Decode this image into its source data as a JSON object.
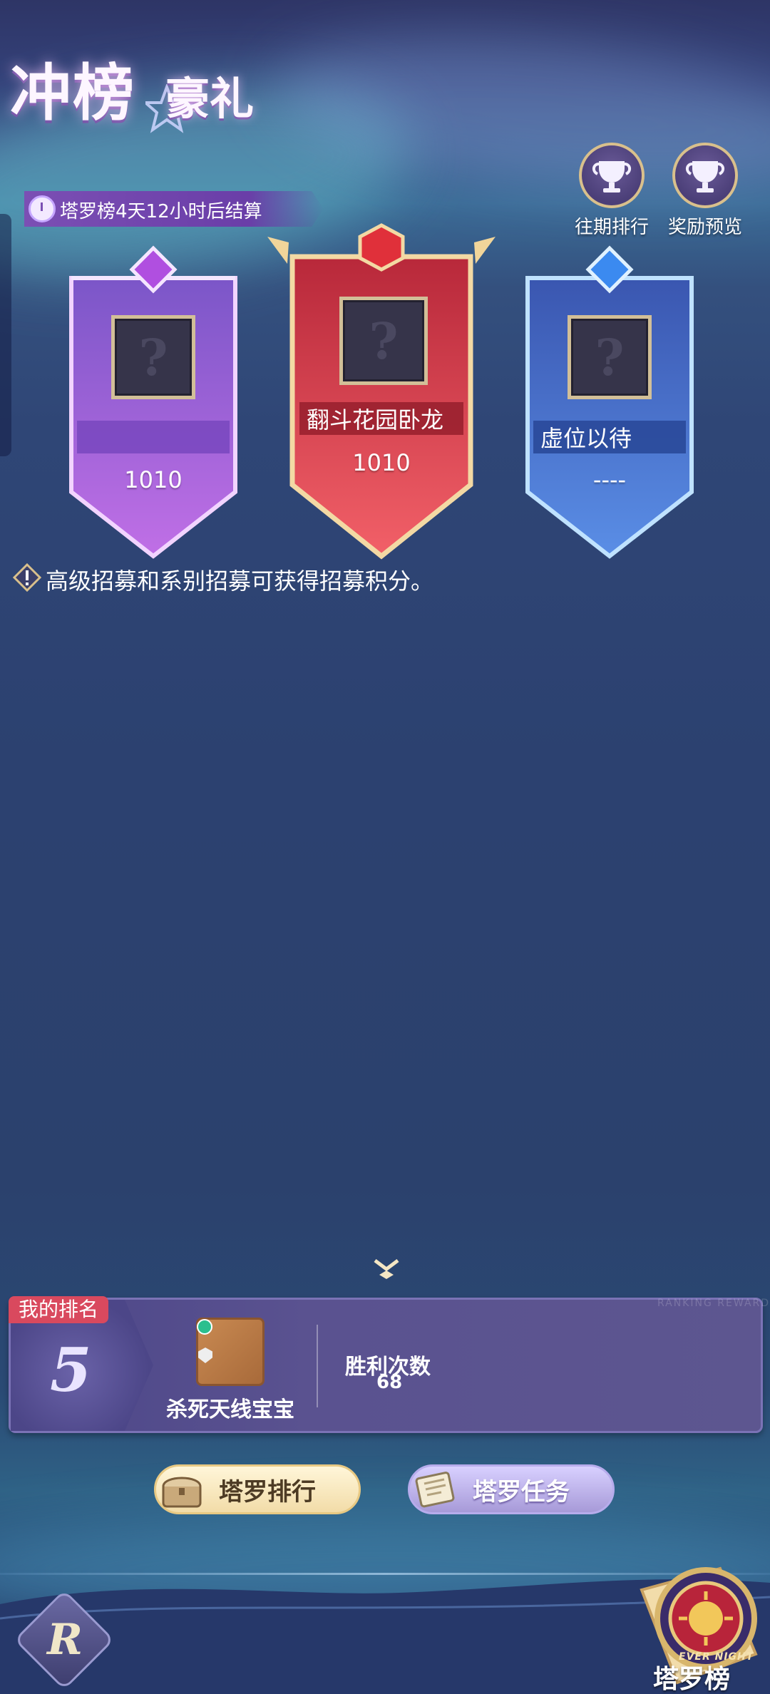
{
  "header": {
    "title_main": "冲榜",
    "title_sub": "豪礼",
    "timer_text": "塔罗榜4天12小时后结算",
    "history_button": "往期排行",
    "rewards_button": "奖励预览"
  },
  "podium": [
    {
      "rank": 2,
      "name": "",
      "score": "1010",
      "color": "#a25fd6",
      "gem_color": "#b04fe0"
    },
    {
      "rank": 1,
      "name": "翻斗花园卧龙",
      "score": "1010",
      "color": "#d94150",
      "gem_color": "#e0303a"
    },
    {
      "rank": 3,
      "name": "虚位以待",
      "score": "----",
      "color": "#4a78d6",
      "gem_color": "#3b8af0"
    }
  ],
  "avatar_placeholder": "?",
  "note": "高级招募和系别招募可获得招募积分。",
  "my_rank": {
    "tag": "我的排名",
    "rank": "5",
    "player_name": "杀死天线宝宝",
    "stat_label": "胜利次数",
    "stat_value": "68",
    "watermark": "RANKING REWARDS"
  },
  "buttons": {
    "ranking": "塔罗排行",
    "tasks": "塔罗任务"
  },
  "footer": {
    "tarot_label": "塔罗榜",
    "tarot_sub": "EVER NIGHT",
    "logo_glyph": "R"
  },
  "colors": {
    "accent_gold": "#d9c08c",
    "rank_tag": "#d9495e"
  }
}
